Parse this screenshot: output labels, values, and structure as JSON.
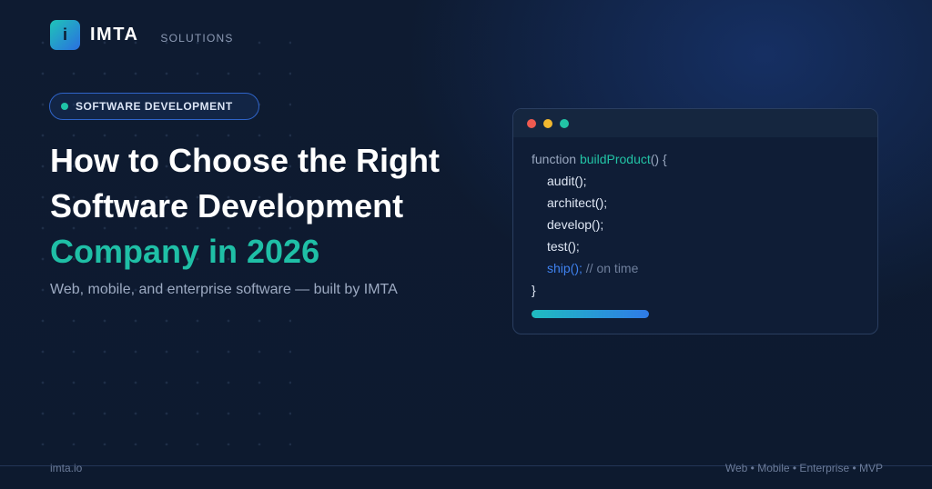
{
  "brand": {
    "logo_letter": "i",
    "name": "IMTA",
    "tagline": "SOLUTIONS"
  },
  "category_pill": {
    "label": "SOFTWARE DEVELOPMENT"
  },
  "headline": {
    "line1": "How to Choose the Right",
    "line2": "Software Development",
    "line3": "Company in 2026"
  },
  "subheadline": "Web, mobile, and enterprise software — built by IMTA",
  "code_card": {
    "keyword": "function",
    "function_name": "buildProduct",
    "signature_tail": "() {",
    "lines": [
      "audit();",
      "architect();",
      "develop();",
      "test();"
    ],
    "ship_call": "ship();",
    "ship_comment": "// on time",
    "closing": "}",
    "progress": 1.0
  },
  "footer": {
    "domain": "imta.io",
    "services": "Web • Mobile • Enterprise • MVP"
  },
  "colors": {
    "background": "#0d1a30",
    "accent_teal": "#1fbfa6",
    "accent_blue": "#2f64c8",
    "window_red": "#ef5a50",
    "window_yellow": "#f2b82f",
    "window_green": "#22c3a5"
  }
}
